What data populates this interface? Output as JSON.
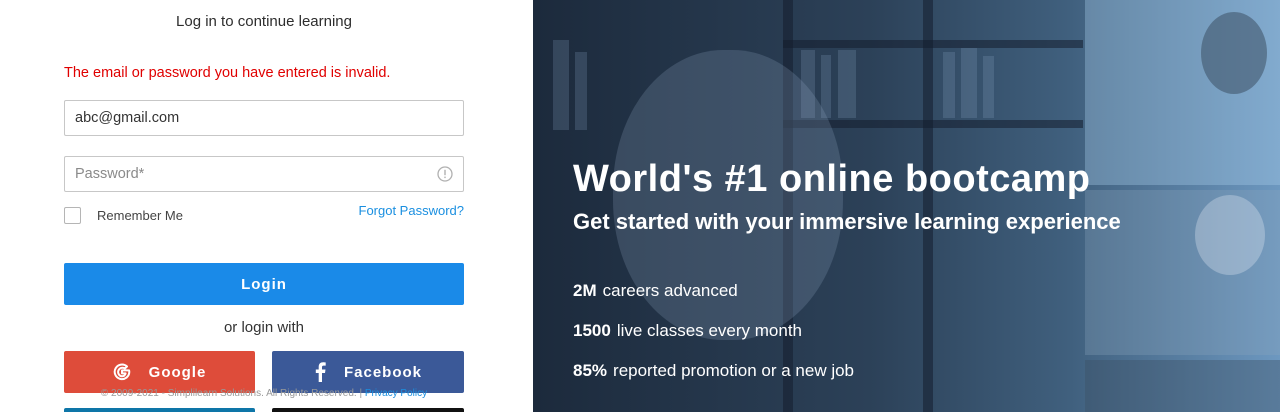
{
  "login": {
    "heading": "Log in to continue learning",
    "error": "The email or password you have entered is invalid.",
    "email_value": "abc@gmail.com",
    "password_placeholder": "Password*",
    "remember_label": "Remember Me",
    "forgot_label": "Forgot Password?",
    "login_label": "Login",
    "or_login_with": "or login with",
    "google_label": "Google",
    "facebook_label": "Facebook",
    "footer_copyright": "© 2009-2021 - Simplilearn Solutions. All Rights Reserved. |",
    "footer_privacy": "Privacy Policy"
  },
  "hero": {
    "title": "World's #1 online bootcamp",
    "subtitle": "Get started with your immersive learning experience",
    "stats": [
      {
        "value": "2M",
        "label": "careers advanced"
      },
      {
        "value": "1500",
        "label": "live classes every month"
      },
      {
        "value": "85%",
        "label": "reported promotion or a new job"
      }
    ]
  },
  "colors": {
    "error": "#e00000",
    "primary": "#1a8ae8",
    "link": "#1a8fe0",
    "google": "#de4c3a",
    "facebook": "#3b5998"
  },
  "icons": {
    "google": "google-icon",
    "facebook": "facebook-icon",
    "info": "info-icon"
  }
}
